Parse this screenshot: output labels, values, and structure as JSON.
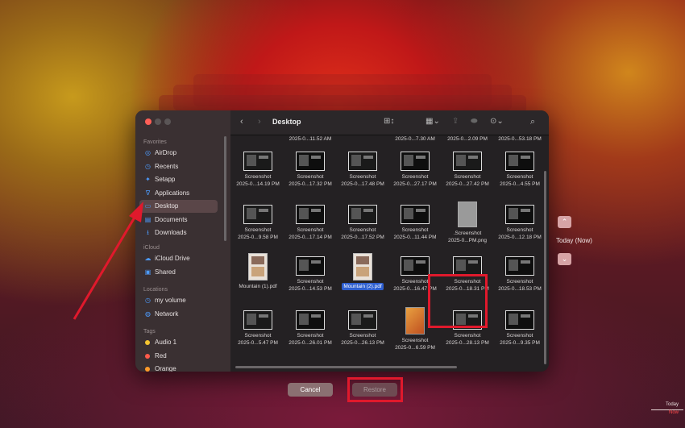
{
  "window": {
    "title": "Desktop",
    "sidebar": {
      "sections": [
        {
          "title": "Favorites",
          "items": [
            {
              "label": "AirDrop",
              "icon": "airdrop-icon"
            },
            {
              "label": "Recents",
              "icon": "clock-icon"
            },
            {
              "label": "Setapp",
              "icon": "setapp-icon"
            },
            {
              "label": "Applications",
              "icon": "applications-icon"
            },
            {
              "label": "Desktop",
              "icon": "desktop-icon",
              "active": true
            },
            {
              "label": "Documents",
              "icon": "document-icon"
            },
            {
              "label": "Downloads",
              "icon": "download-icon"
            }
          ]
        },
        {
          "title": "iCloud",
          "items": [
            {
              "label": "iCloud Drive",
              "icon": "cloud-icon"
            },
            {
              "label": "Shared",
              "icon": "shared-folder-icon"
            }
          ]
        },
        {
          "title": "Locations",
          "items": [
            {
              "label": "my volume",
              "icon": "clock-icon"
            },
            {
              "label": "Network",
              "icon": "globe-icon"
            }
          ]
        },
        {
          "title": "Tags",
          "items": [
            {
              "label": "Audio 1",
              "color": "#f4c430"
            },
            {
              "label": "Red",
              "color": "#ff5a4a"
            },
            {
              "label": "Orange",
              "color": "#ff9a2a"
            }
          ]
        }
      ]
    },
    "files": {
      "top_partial": [
        "2025-0...11.52 AM",
        "2025-0...7.30 AM",
        "2025-0...2.09 PM",
        "2025-0...53.18 PM"
      ],
      "rows": [
        [
          {
            "line1": "Screenshot",
            "line2": "2025-0...14.19 PM",
            "kind": "shot"
          },
          {
            "line1": "Screenshot",
            "line2": "2025-0...17.32 PM",
            "kind": "shot"
          },
          {
            "line1": "Screenshot",
            "line2": "2025-0...17.48 PM",
            "kind": "shot"
          },
          {
            "line1": "Screenshot",
            "line2": "2025-0...27.17 PM",
            "kind": "shot"
          },
          {
            "line1": "Screenshot",
            "line2": "2025-0...27.42 PM",
            "kind": "shot"
          },
          {
            "line1": "Screenshot",
            "line2": "2025-0...4.55 PM",
            "kind": "shot"
          }
        ],
        [
          {
            "line1": "Screenshot",
            "line2": "2025-0...9.58 PM",
            "kind": "shot"
          },
          {
            "line1": "Screenshot",
            "line2": "2025-0...17.14 PM",
            "kind": "shot"
          },
          {
            "line1": "Screenshot",
            "line2": "2025-0...17.52 PM",
            "kind": "shot"
          },
          {
            "line1": "Screenshot",
            "line2": "2025-0...11.44 PM",
            "kind": "shot"
          },
          {
            "line1": ".Screenshot",
            "line2": "2025-0...PM.png",
            "kind": "png"
          },
          {
            "line1": "Screenshot",
            "line2": "2025-0...12.18 PM",
            "kind": "shot"
          }
        ],
        [
          {
            "line1": "Mountain (1).pdf",
            "line2": "",
            "kind": "pdf"
          },
          {
            "line1": "Screenshot",
            "line2": "2025-0...14.53 PM",
            "kind": "shot"
          },
          {
            "line1": "Mountain (2).pdf",
            "line2": "",
            "kind": "pdf",
            "selected": true
          },
          {
            "line1": "Screenshot",
            "line2": "2025-0...16.47 PM",
            "kind": "shot"
          },
          {
            "line1": "Screenshot",
            "line2": "2025-0...18.31 PM",
            "kind": "shot"
          },
          {
            "line1": "Screenshot",
            "line2": "2025-0...18.53 PM",
            "kind": "shot"
          }
        ],
        [
          {
            "line1": "Screenshot",
            "line2": "2025-0...5.47 PM",
            "kind": "shot"
          },
          {
            "line1": "Screenshot",
            "line2": "2025-0...26.01 PM",
            "kind": "shot"
          },
          {
            "line1": "Screenshot",
            "line2": "2025-0...26.13 PM",
            "kind": "shot"
          },
          {
            "line1": "Screenshot",
            "line2": "2025-0...6.59 PM",
            "kind": "orange"
          },
          {
            "line1": "Screenshot",
            "line2": "2025-0...28.13 PM",
            "kind": "shot"
          },
          {
            "line1": "Screenshot",
            "line2": "2025-0...9.35 PM",
            "kind": "shot"
          }
        ]
      ]
    }
  },
  "buttons": {
    "cancel": "Cancel",
    "restore": "Restore"
  },
  "timemachine": {
    "current": "Today (Now)",
    "timeline_today": "Today",
    "timeline_now": "Now"
  },
  "colors": {
    "highlight": "#e0192c",
    "selection": "#2e5fd0",
    "annotation_arrow": "#e0192c"
  }
}
